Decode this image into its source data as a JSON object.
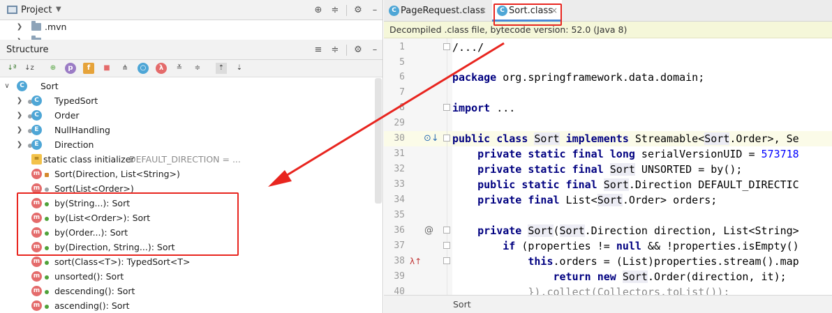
{
  "project_panel": {
    "title": "Project",
    "items": [
      {
        "label": ".mvn"
      },
      {
        "label": "src"
      }
    ]
  },
  "structure_panel": {
    "title": "Structure",
    "root": {
      "label": "Sort",
      "icon": "c"
    },
    "items": [
      {
        "label": "TypedSort",
        "icon": "c"
      },
      {
        "label": "Order",
        "icon": "c"
      },
      {
        "label": "NullHandling",
        "icon": "e"
      },
      {
        "label": "Direction",
        "icon": "e"
      },
      {
        "label": "static class initializer",
        "extra": "DEFAULT_DIRECTION = ...",
        "icon": "init"
      },
      {
        "label": "Sort(Direction, List<String>)",
        "icon": "m"
      },
      {
        "label": "Sort(List<Order>)",
        "icon": "m"
      },
      {
        "label": "by(String...): Sort",
        "icon": "m"
      },
      {
        "label": "by(List<Order>): Sort",
        "icon": "m"
      },
      {
        "label": "by(Order...): Sort",
        "icon": "m"
      },
      {
        "label": "by(Direction, String...): Sort",
        "icon": "m"
      },
      {
        "label": "sort(Class<T>): TypedSort<T>",
        "icon": "m"
      },
      {
        "label": "unsorted(): Sort",
        "icon": "m"
      },
      {
        "label": "descending(): Sort",
        "icon": "m"
      },
      {
        "label": "ascending(): Sort",
        "icon": "m"
      }
    ]
  },
  "toolbar_icons": {
    "c_letter": "C",
    "e_letter": "E",
    "m_letter": "m",
    "p_letter": "p",
    "f_letter": "f",
    "lambda": "λ"
  },
  "editor": {
    "tabs": [
      {
        "label": "PageRequest.class",
        "close": "×"
      },
      {
        "label": "Sort.class",
        "close": "×"
      }
    ],
    "banner": "Decompiled .class file, bytecode version: 52.0 (Java 8)",
    "line_numbers": [
      "1",
      "5",
      "6",
      "7",
      "8",
      "29",
      "30",
      "31",
      "32",
      "33",
      "34",
      "35",
      "36",
      "37",
      "38",
      "39",
      "40"
    ],
    "code": {
      "l1": "/.../",
      "l6_kw": "package",
      "l6_rest": " org.springframework.data.domain;",
      "l8_kw": "import",
      "l8_rest": " ...",
      "l30_a": "public class",
      "l30_b": " ",
      "l30_c": "Sort",
      "l30_d": " ",
      "l30_e": "implements",
      "l30_f": " Streamable<",
      "l30_g": "Sort",
      "l30_h": ".Order>, Se",
      "l31_kw": "private static final long",
      "l31_rest": " serialVersionUID = ",
      "l31_num": "573718",
      "l32_kw": "private static final",
      "l32_a": " ",
      "l32_ref": "Sort",
      "l32_rest": " UNSORTED = by();",
      "l33_kw": "public static final",
      "l33_a": " ",
      "l33_ref": "Sort",
      "l33_rest": ".Direction DEFAULT_DIRECTIC",
      "l34_kw": "private final",
      "l34_a": " List<",
      "l34_ref": "Sort",
      "l34_rest": ".Order> orders;",
      "l36_kw": "private",
      "l36_a": " ",
      "l36_ref": "Sort",
      "l36_b": "(",
      "l36_ref2": "Sort",
      "l36_rest": ".Direction direction, List<String>",
      "l37_kw": "if",
      "l37_a": " (properties != ",
      "l37_kw2": "null",
      "l37_rest": " && !properties.isEmpty()",
      "l38_kw": "this",
      "l38_rest": ".orders = (List)properties.stream().map",
      "l39_kw": "return new",
      "l39_a": " ",
      "l39_ref": "Sort",
      "l39_rest": ".Order(direction, it);",
      "l40": "}).collect(Collectors.toList());"
    },
    "gutter_marks": {
      "at": "@",
      "lambda": "λ↑",
      "impl": "⊙↓"
    },
    "status": "Sort"
  },
  "colors": {
    "annotation": "#e8251f",
    "class_icon": "#4ea6d6",
    "method_icon": "#e46b6b",
    "keyword": "#000080"
  }
}
